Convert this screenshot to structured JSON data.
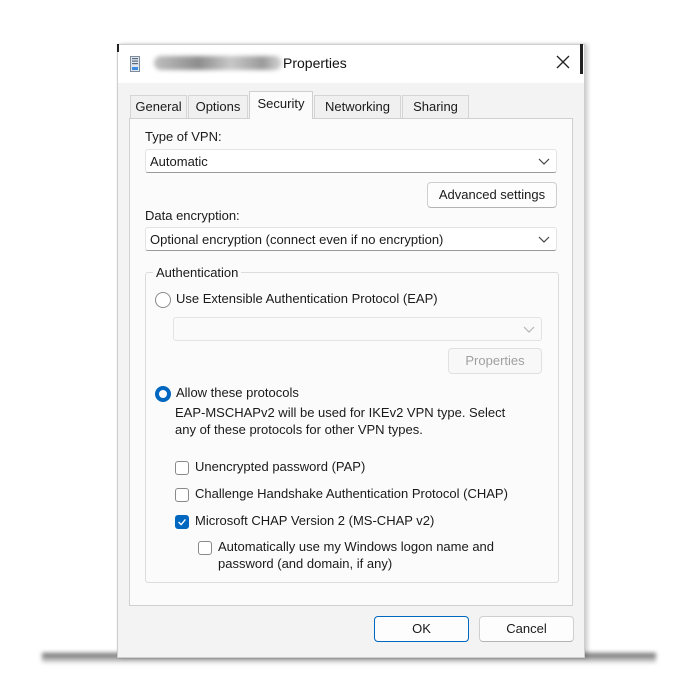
{
  "window": {
    "title": "Properties",
    "close_glyph": "✕"
  },
  "tabs": [
    {
      "label": "General"
    },
    {
      "label": "Options"
    },
    {
      "label": "Security"
    },
    {
      "label": "Networking"
    },
    {
      "label": "Sharing"
    }
  ],
  "active_tab": "Security",
  "vpn_type": {
    "label": "Type of VPN:",
    "value": "Automatic"
  },
  "advanced_settings_button": "Advanced settings",
  "data_encryption": {
    "label": "Data encryption:",
    "value": "Optional encryption (connect even if no encryption)"
  },
  "authentication": {
    "legend": "Authentication",
    "eap_option": "Use Extensible Authentication Protocol (EAP)",
    "eap_selected": false,
    "eap_combo_value": "",
    "eap_properties_button": "Properties",
    "allow_protocols_option": "Allow these protocols",
    "allow_protocols_selected": true,
    "description_line1": "EAP-MSCHAPv2 will be used for IKEv2 VPN type. Select",
    "description_line2": "any of these protocols for other VPN types.",
    "checkboxes": [
      {
        "label": "Unencrypted password (PAP)",
        "checked": false
      },
      {
        "label": "Challenge Handshake Authentication Protocol (CHAP)",
        "checked": false
      },
      {
        "label": "Microsoft CHAP Version 2 (MS-CHAP v2)",
        "checked": true
      }
    ],
    "windows_logon": {
      "line1": "Automatically use my Windows logon name and",
      "line2": "password (and domain, if any)",
      "checked": false
    }
  },
  "footer": {
    "ok": "OK",
    "cancel": "Cancel"
  },
  "colors": {
    "accent": "#0067c0",
    "window_bg": "#f3f3f3",
    "panel_bg": "#fbfbfb"
  },
  "icons": [
    "network-connection-icon",
    "close-icon",
    "chevron-down-icon",
    "checkmark-icon"
  ]
}
